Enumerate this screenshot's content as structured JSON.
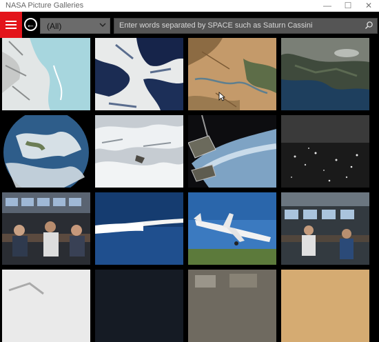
{
  "window": {
    "title": "NASA Picture Galleries",
    "controls": [
      "minimize-icon",
      "maximize-icon",
      "close-icon"
    ],
    "minimize_glyph": "—",
    "maximize_glyph": "☐",
    "close_glyph": "✕"
  },
  "toolbar": {
    "accent_color": "#e3141b",
    "back_glyph": "←",
    "category": {
      "selected": "(All)"
    },
    "search": {
      "placeholder": "Enter words separated by SPACE such as    Saturn Cassini"
    }
  },
  "gallery": {
    "images": [
      {
        "subject": "satellite view of ice and snow with blue meltwater"
      },
      {
        "subject": "aerial view of snow-covered islands with dark water"
      },
      {
        "subject": "satellite view of desert canyon terrain"
      },
      {
        "subject": "satellite view of coastline and forest"
      },
      {
        "subject": "full disk view of Earth"
      },
      {
        "subject": "clouds viewed from orbit with spacecraft"
      },
      {
        "subject": "space station solar arrays over Earth"
      },
      {
        "subject": "night lights view from orbit"
      },
      {
        "subject": "mission control room with people at consoles"
      },
      {
        "subject": "rocket launch plume"
      },
      {
        "subject": "airliner aircraft taking off"
      },
      {
        "subject": "control room with people at computer terminals"
      },
      {
        "subject": "partially visible image"
      },
      {
        "subject": "partially visible dark image"
      },
      {
        "subject": "partially visible room image"
      },
      {
        "subject": "partially visible sandy image"
      }
    ]
  }
}
